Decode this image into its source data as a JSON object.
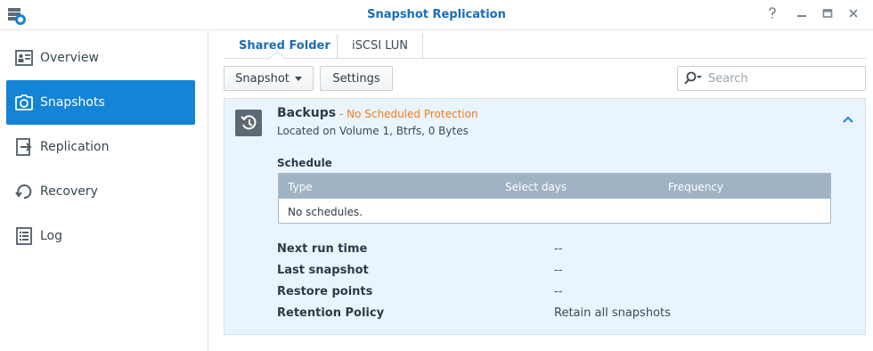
{
  "window": {
    "title": "Snapshot Replication",
    "controls": [
      "help-icon",
      "minimize-icon",
      "maximize-icon",
      "close-icon"
    ]
  },
  "sidebar": {
    "items": [
      {
        "label": "Overview",
        "icon": "overview-icon",
        "active": false
      },
      {
        "label": "Snapshots",
        "icon": "camera-icon",
        "active": true
      },
      {
        "label": "Replication",
        "icon": "replication-icon",
        "active": false
      },
      {
        "label": "Recovery",
        "icon": "recovery-icon",
        "active": false
      },
      {
        "label": "Log",
        "icon": "log-icon",
        "active": false
      }
    ]
  },
  "tabs": [
    {
      "label": "Shared Folder",
      "active": true
    },
    {
      "label": "iSCSI LUN",
      "active": false
    }
  ],
  "toolbar": {
    "snapshot_label": "Snapshot",
    "settings_label": "Settings",
    "search_placeholder": "Search"
  },
  "panel": {
    "name": "Backups",
    "status": "- No Scheduled Protection",
    "location": "Located on Volume 1, Btrfs, 0 Bytes",
    "schedule_label": "Schedule",
    "schedule_columns": [
      "Type",
      "Select days",
      "Frequency"
    ],
    "schedule_empty": "No schedules.",
    "info": [
      {
        "label": "Next run time",
        "value": "--"
      },
      {
        "label": "Last snapshot",
        "value": "--"
      },
      {
        "label": "Restore points",
        "value": "--"
      },
      {
        "label": "Retention Policy",
        "value": "Retain all snapshots"
      }
    ]
  },
  "colors": {
    "accent": "#1384d6",
    "title": "#1a6eb5",
    "warning": "#f07d1a",
    "panel_bg": "#eaf4fd",
    "table_header": "#9fb3c4"
  }
}
